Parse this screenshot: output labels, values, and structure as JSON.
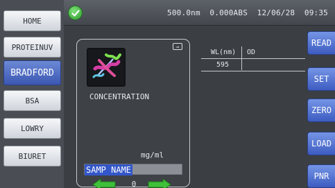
{
  "sidebar": {
    "items": [
      {
        "label": "HOME"
      },
      {
        "label": "PROTEINUV"
      },
      {
        "label": "BRADFORD",
        "active": true
      },
      {
        "label": "BSA"
      },
      {
        "label": "LOWRY"
      },
      {
        "label": "BIURET"
      }
    ]
  },
  "status": {
    "icon": "check-circle-icon",
    "readout": "500.0nm  0.000ABS  12/06/28  09:35"
  },
  "card": {
    "logo_icon": "protein-ribbon-icon",
    "corner_icon": "export-icon",
    "concentration_label": "CONCENTRATION",
    "unit": "mg/ml",
    "sample_name": "SAMP NAME",
    "index": "0"
  },
  "table": {
    "headers": [
      "WL(nm)",
      "OD"
    ],
    "rows": [
      [
        "595",
        ""
      ]
    ]
  },
  "actions": [
    {
      "label": "READ"
    },
    {
      "label": "SET"
    },
    {
      "label": "ZERO"
    },
    {
      "label": "LOAD"
    },
    {
      "label": "PNR"
    }
  ],
  "colors": {
    "accent_blue": "#3d5cc1",
    "ok_green": "#2e9c2c",
    "arrow_green": "#3fbf3a"
  }
}
